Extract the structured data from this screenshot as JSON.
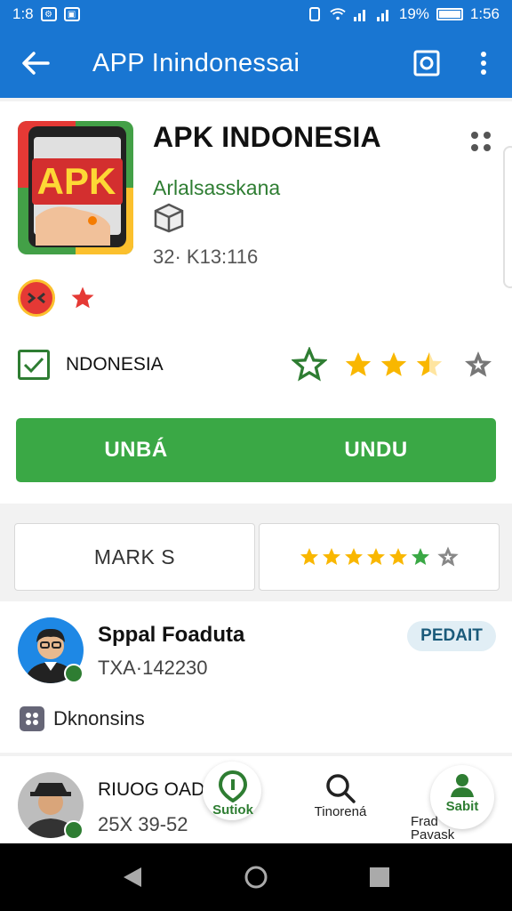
{
  "status_bar": {
    "time_left": "1:8",
    "battery_percent": "19%",
    "time_right": "1:56"
  },
  "app_bar": {
    "title": "APP Inindonessai"
  },
  "app": {
    "name": "APK INDONESIA",
    "icon_text": "APK",
    "developer": "Arlalsasskana",
    "size": "32· K13:116"
  },
  "region": {
    "label": "NDONESIA",
    "rating_stars": 2.5,
    "rating_out_of": 3
  },
  "download": {
    "left_label": "UNBÁ",
    "right_label": "UNDU"
  },
  "tabs": {
    "marks_label": "MARK S",
    "rating_stars": 4.5
  },
  "review": {
    "name": "Sppal Foaduta",
    "meta": "TXA·142230",
    "pill": "PEDAIT",
    "category": "Dknonsins"
  },
  "review2": {
    "name": "RIUOG OADIL",
    "meta": "25X  39-52"
  },
  "bottom_nav": {
    "item1": "Sutiok",
    "item2": "Tinorená",
    "item3a": "Frad",
    "item3b": "Pavask",
    "item4": "Sabit"
  },
  "colors": {
    "primary": "#1976d2",
    "download_green": "#3aa845",
    "developer_green": "#2e7d32",
    "star_yellow": "#f9b700"
  }
}
